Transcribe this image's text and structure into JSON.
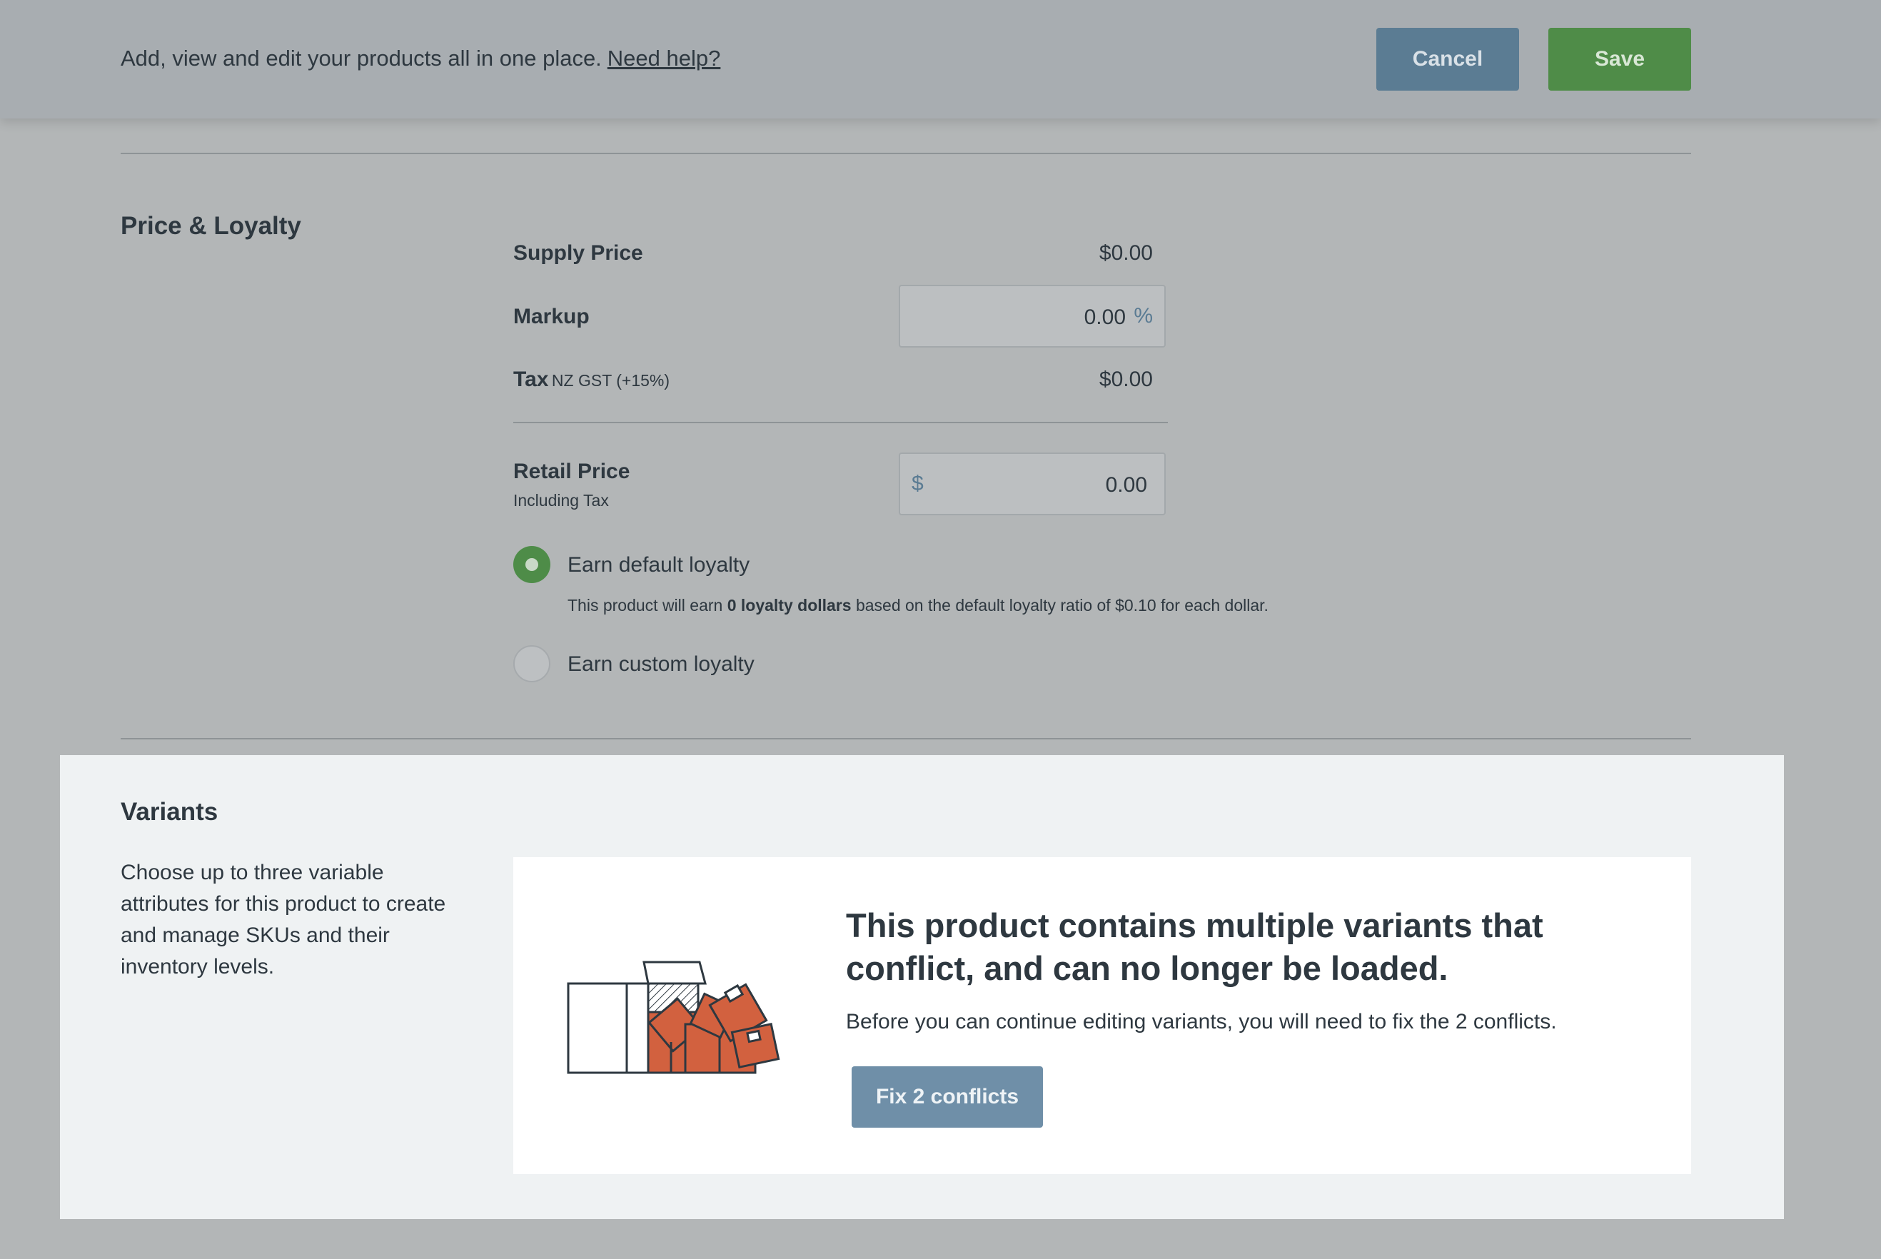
{
  "header": {
    "description": "Add, view and edit your products all in one place.",
    "help_link": "Need help?",
    "cancel_label": "Cancel",
    "save_label": "Save"
  },
  "price_loyalty": {
    "title": "Price & Loyalty",
    "supply_price": {
      "label": "Supply Price",
      "value": "$0.00"
    },
    "markup": {
      "label": "Markup",
      "value": "0.00",
      "unit": "%"
    },
    "tax": {
      "label": "Tax",
      "detail": "NZ GST (+15%)",
      "value": "$0.00"
    },
    "retail_price": {
      "label": "Retail Price",
      "sublabel": "Including Tax",
      "currency": "$",
      "value": "0.00"
    },
    "loyalty": {
      "default_label": "Earn default loyalty",
      "default_selected": true,
      "note_prefix": "This product will earn",
      "note_bold": "0 loyalty dollars",
      "note_suffix": "based on the default loyalty ratio of $0.10 for each dollar.",
      "custom_label": "Earn custom loyalty",
      "custom_selected": false
    }
  },
  "variants": {
    "title": "Variants",
    "description": "Choose up to three variable attributes for this product to create and manage SKUs and their inventory levels.",
    "conflict_title": "This product contains multiple variants that conflict, and can no longer be loaded.",
    "conflict_text": "Before you can continue editing variants, you will need to fix the 2 conflicts.",
    "fix_button_label": "Fix 2 conflicts"
  },
  "colors": {
    "save": "#4f8c48",
    "cancel": "#5b7c93",
    "box_orange": "#d2613f",
    "fix_button": "#6f8fa8"
  }
}
